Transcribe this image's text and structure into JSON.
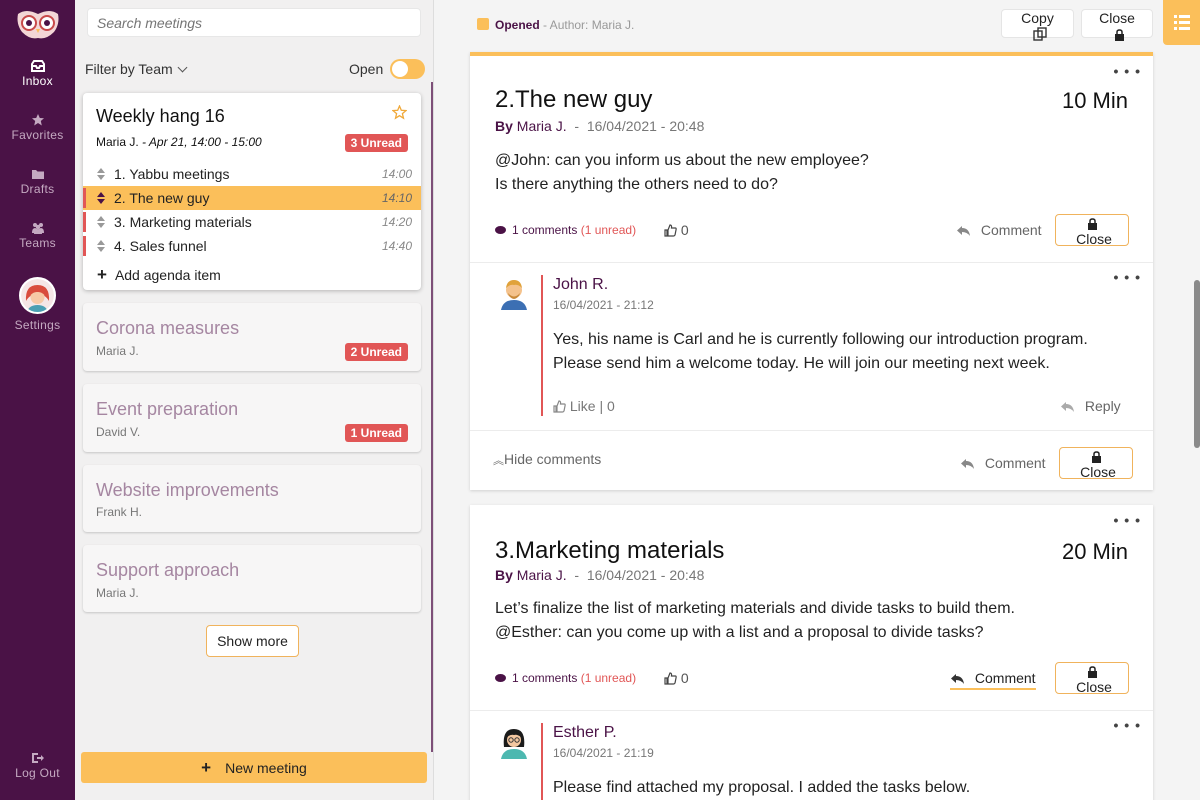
{
  "nav": {
    "items": [
      {
        "label": "Inbox",
        "icon": "inbox-icon"
      },
      {
        "label": "Favorites",
        "icon": "star-icon"
      },
      {
        "label": "Drafts",
        "icon": "folder-icon"
      },
      {
        "label": "Teams",
        "icon": "people-icon"
      },
      {
        "label": "Settings",
        "icon": "avatar"
      }
    ],
    "logout": "Log Out"
  },
  "sidebar": {
    "search_placeholder": "Search meetings",
    "filter_label": "Filter by Team",
    "open_label": "Open",
    "open_toggle_on": true,
    "meetings": [
      {
        "title": "Weekly hang 16",
        "author": "Maria J.",
        "when": "- Apr 21, 14:00 - 15:00",
        "badge": "3 Unread",
        "agenda": [
          {
            "label": "1.  Yabbu meetings",
            "time": "14:00"
          },
          {
            "label": "2.  The new guy",
            "time": "14:10"
          },
          {
            "label": "3.  Marketing materials",
            "time": "14:20"
          },
          {
            "label": "4.  Sales funnel",
            "time": "14:40"
          }
        ],
        "add_label": "Add agenda item"
      },
      {
        "title": "Corona measures",
        "author": "Maria J.",
        "badge": "2 Unread"
      },
      {
        "title": "Event preparation",
        "author": "David V.",
        "badge": "1 Unread"
      },
      {
        "title": "Website improvements",
        "author": "Frank H."
      },
      {
        "title": "Support approach",
        "author": "Maria J."
      }
    ],
    "show_more": "Show more",
    "new_meeting": "New meeting"
  },
  "topbar": {
    "status": "Opened",
    "author": "- Author: Maria J.",
    "copy": "Copy",
    "close": "Close"
  },
  "posts": [
    {
      "title": "2.The new guy",
      "duration": "10 Min",
      "by": "By",
      "author": "Maria J.",
      "date": "16/04/2021 - 20:48",
      "lines": [
        "@John: can you inform us about the new employee?",
        "Is there anything the others need to do?"
      ],
      "comments_count": "1 comments",
      "comments_unread": "(1 unread)",
      "likes": "0",
      "comment_label": "Comment",
      "close_label": "Close",
      "comments": [
        {
          "name": "John R.",
          "date": "16/04/2021 - 21:12",
          "lines": [
            "Yes, his name is Carl and he is currently following our introduction program.",
            "Please send him a welcome today. He will join our meeting next week."
          ],
          "like": "Like | 0",
          "reply": "Reply"
        }
      ],
      "hide_comments": "Hide comments"
    },
    {
      "title": "3.Marketing materials",
      "duration": "20 Min",
      "by": "By",
      "author": "Maria J.",
      "date": "16/04/2021 - 20:48",
      "lines": [
        "Let’s finalize the list of marketing materials and divide tasks to build them.",
        "@Esther: can you come up with a list and a proposal to divide tasks?"
      ],
      "comments_count": "1 comments",
      "comments_unread": "(1 unread)",
      "likes": "0",
      "comment_label": "Comment",
      "close_label": "Close",
      "comments": [
        {
          "name": "Esther P.",
          "date": "16/04/2021 - 21:19",
          "lines": [
            "Please find attached my proposal. I added the tasks below."
          ]
        }
      ]
    }
  ],
  "colors": {
    "brand": "#4a1246",
    "accent": "#fbbf5a",
    "unread": "#e15656"
  }
}
